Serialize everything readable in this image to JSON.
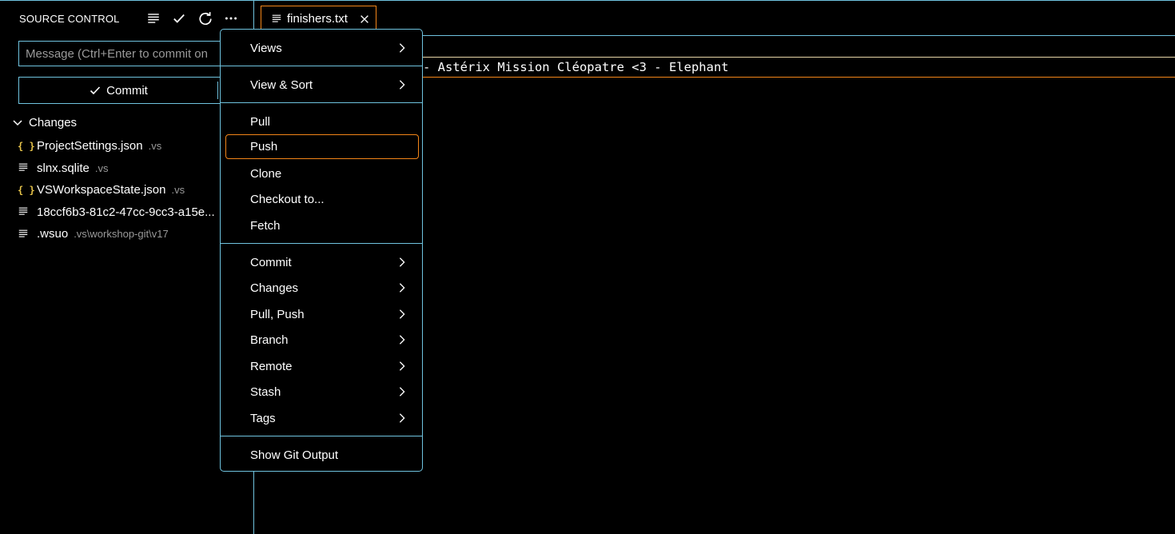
{
  "sidebar": {
    "title": "SOURCE CONTROL",
    "header_icons": [
      "view-as-list-icon",
      "checkmark-icon",
      "refresh-icon",
      "more-actions-icon"
    ],
    "message_placeholder": "Message (Ctrl+Enter to commit on",
    "commit_label": "Commit",
    "changes_label": "Changes",
    "files": [
      {
        "icon": "json-icon",
        "name": "ProjectSettings.json",
        "dir": ".vs"
      },
      {
        "icon": "file-text-icon",
        "name": "slnx.sqlite",
        "dir": ".vs"
      },
      {
        "icon": "json-icon",
        "name": "VSWorkspaceState.json",
        "dir": ".vs"
      },
      {
        "icon": "file-text-icon",
        "name": "18ccf6b3-81c2-47cc-9cc3-a15e...",
        "dir": ""
      },
      {
        "icon": "file-text-icon",
        "name": ".wsuo",
        "dir": ".vs\\workshop-git\\v17"
      }
    ]
  },
  "editor": {
    "tab_label": "finishers.txt",
    "line_text": "- Astérix Mission Cléopatre <3 - Elephant"
  },
  "menu": {
    "items": [
      {
        "label": "Views",
        "submenu": true
      },
      {
        "label": "View & Sort",
        "submenu": true
      },
      {
        "label": "Pull",
        "submenu": false
      },
      {
        "label": "Push",
        "submenu": false,
        "focused": true
      },
      {
        "label": "Clone",
        "submenu": false
      },
      {
        "label": "Checkout to...",
        "submenu": false
      },
      {
        "label": "Fetch",
        "submenu": false
      },
      {
        "label": "Commit",
        "submenu": true
      },
      {
        "label": "Changes",
        "submenu": true
      },
      {
        "label": "Pull, Push",
        "submenu": true
      },
      {
        "label": "Branch",
        "submenu": true
      },
      {
        "label": "Remote",
        "submenu": true
      },
      {
        "label": "Stash",
        "submenu": true
      },
      {
        "label": "Tags",
        "submenu": true
      },
      {
        "label": "Show Git Output",
        "submenu": false
      }
    ]
  },
  "colors": {
    "background": "#000000",
    "contrast_border": "#6fc3df",
    "active_border": "#f38518",
    "json_icon": "#e6c34a",
    "muted_text": "#9a9a9a"
  }
}
